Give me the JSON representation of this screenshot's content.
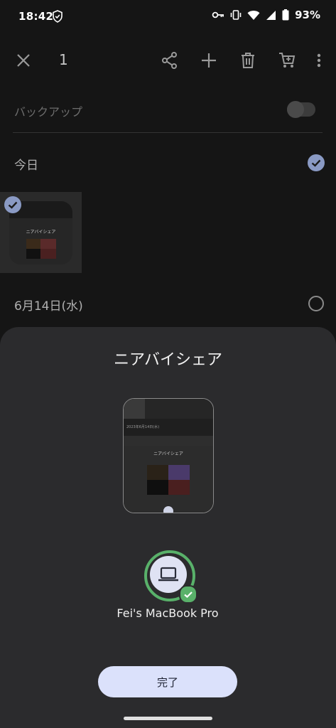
{
  "status_bar": {
    "time": "18:42",
    "battery_percent": "93%",
    "icons": [
      "shield-icon",
      "key-icon",
      "vibrate-icon",
      "wifi-icon",
      "signal-icon",
      "battery-icon"
    ]
  },
  "top_bar": {
    "close_icon": "close-icon",
    "selected_count": "1",
    "actions": [
      "share-icon",
      "add-icon",
      "delete-icon",
      "cart-icon",
      "more-vert-icon"
    ]
  },
  "background_list": {
    "backup_label": "バックアップ",
    "backup_enabled": false,
    "today_label": "今日",
    "today_selected": true,
    "thumbnail_title": "ニアバイシェア",
    "date_label": "6月14日(水)",
    "date_selected": false
  },
  "sheet": {
    "title": "ニアバイシェア",
    "preview_caption": "ニアバイシェア",
    "preview_date": "2023年6月14日(水)",
    "device_name": "Fei's MacBook Pro",
    "device_icon": "laptop-icon",
    "device_status": "sent",
    "done_label": "完了"
  },
  "colors": {
    "accent_green": "#59b16a",
    "button_bg": "#dbe1fb",
    "sheet_bg": "#2b2b2d",
    "check_blue": "#8a9ac4"
  }
}
